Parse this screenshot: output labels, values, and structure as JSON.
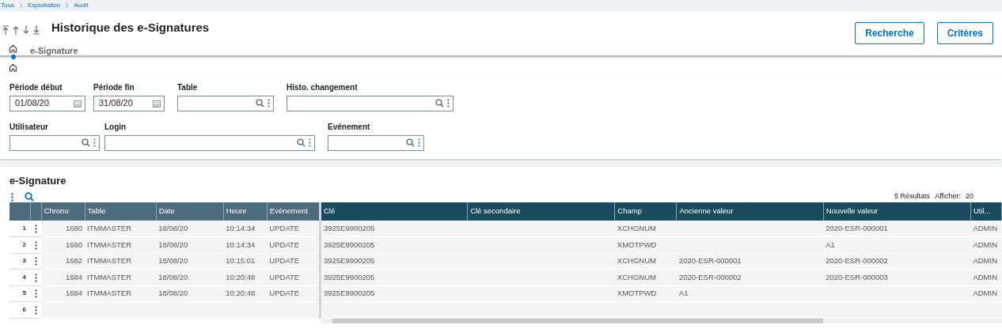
{
  "breadcrumb": [
    "Tous",
    "Exploitation",
    "Audit"
  ],
  "title": "Historique des e-Signatures",
  "buttons": [
    "Recherche",
    "Critères"
  ],
  "tabs": [
    {
      "kind": "home",
      "selected": true
    },
    {
      "kind": "text",
      "label": "e-Signature",
      "selected": false
    }
  ],
  "filters": [
    [
      {
        "label": "Période début",
        "kind": "date",
        "value": "01/08/20"
      },
      {
        "label": "Période fin",
        "kind": "date",
        "value": "31/08/20"
      },
      {
        "label": "Table",
        "kind": "lookup"
      },
      {
        "label": "Histo. changement",
        "kind": "lookup"
      }
    ],
    [
      {
        "label": "Utilisateur",
        "kind": "lookup"
      },
      {
        "label": "Login",
        "kind": "lookup"
      },
      {
        "label": "Evénement",
        "kind": "lookup"
      }
    ]
  ],
  "grid": {
    "title": "e-Signature",
    "results": "5 Résultats",
    "show_label": "Afficher:",
    "show_value": "20",
    "columns": [
      {
        "label": "Chrono",
        "frozen": true
      },
      {
        "label": "Table",
        "frozen": true
      },
      {
        "label": "Date",
        "frozen": true
      },
      {
        "label": "Heure",
        "frozen": true
      },
      {
        "label": "Evénement",
        "frozen": true
      },
      {
        "label": "Clé",
        "frozen": false
      },
      {
        "label": "Clé secondaire",
        "frozen": false
      },
      {
        "label": "Champ",
        "frozen": false
      },
      {
        "label": "Ancienne valeur",
        "frozen": false
      },
      {
        "label": "Nouvelle valeur",
        "frozen": false
      },
      {
        "label": "Util...",
        "frozen": false
      }
    ],
    "rows": [
      {
        "number": "1",
        "cells": [
          "1680",
          "ITMMASTER",
          "18/08/20",
          "10:14:34",
          "UPDATE",
          "3925E9900205",
          "",
          "XCHGNUM",
          "",
          "2020-ESR-000001",
          "ADMIN"
        ]
      },
      {
        "number": "2",
        "cells": [
          "1680",
          "ITMMASTER",
          "18/08/20",
          "10:14:34",
          "UPDATE",
          "3925E9900205",
          "",
          "XMOTPWD",
          "",
          "A1",
          "ADMIN"
        ]
      },
      {
        "number": "3",
        "cells": [
          "1682",
          "ITMMASTER",
          "18/08/20",
          "10:15:01",
          "UPDATE",
          "3925E9900205",
          "",
          "XCHGNUM",
          "2020-ESR-000001",
          "2020-ESR-000002",
          "ADMIN"
        ]
      },
      {
        "number": "4",
        "cells": [
          "1684",
          "ITMMASTER",
          "18/08/20",
          "10:20:48",
          "UPDATE",
          "3925E9900205",
          "",
          "XCHGNUM",
          "2020-ESR-000002",
          "2020-ESR-000003",
          "ADMIN"
        ]
      },
      {
        "number": "5",
        "cells": [
          "1684",
          "ITMMASTER",
          "18/08/20",
          "10:20:48",
          "UPDATE",
          "3925E9900205",
          "",
          "XMOTPWD",
          "A1",
          "",
          "ADMIN"
        ]
      },
      {
        "number": "6",
        "cells": [
          "",
          "",
          "",
          "",
          "",
          "",
          "",
          "",
          "",
          "",
          ""
        ]
      }
    ]
  }
}
